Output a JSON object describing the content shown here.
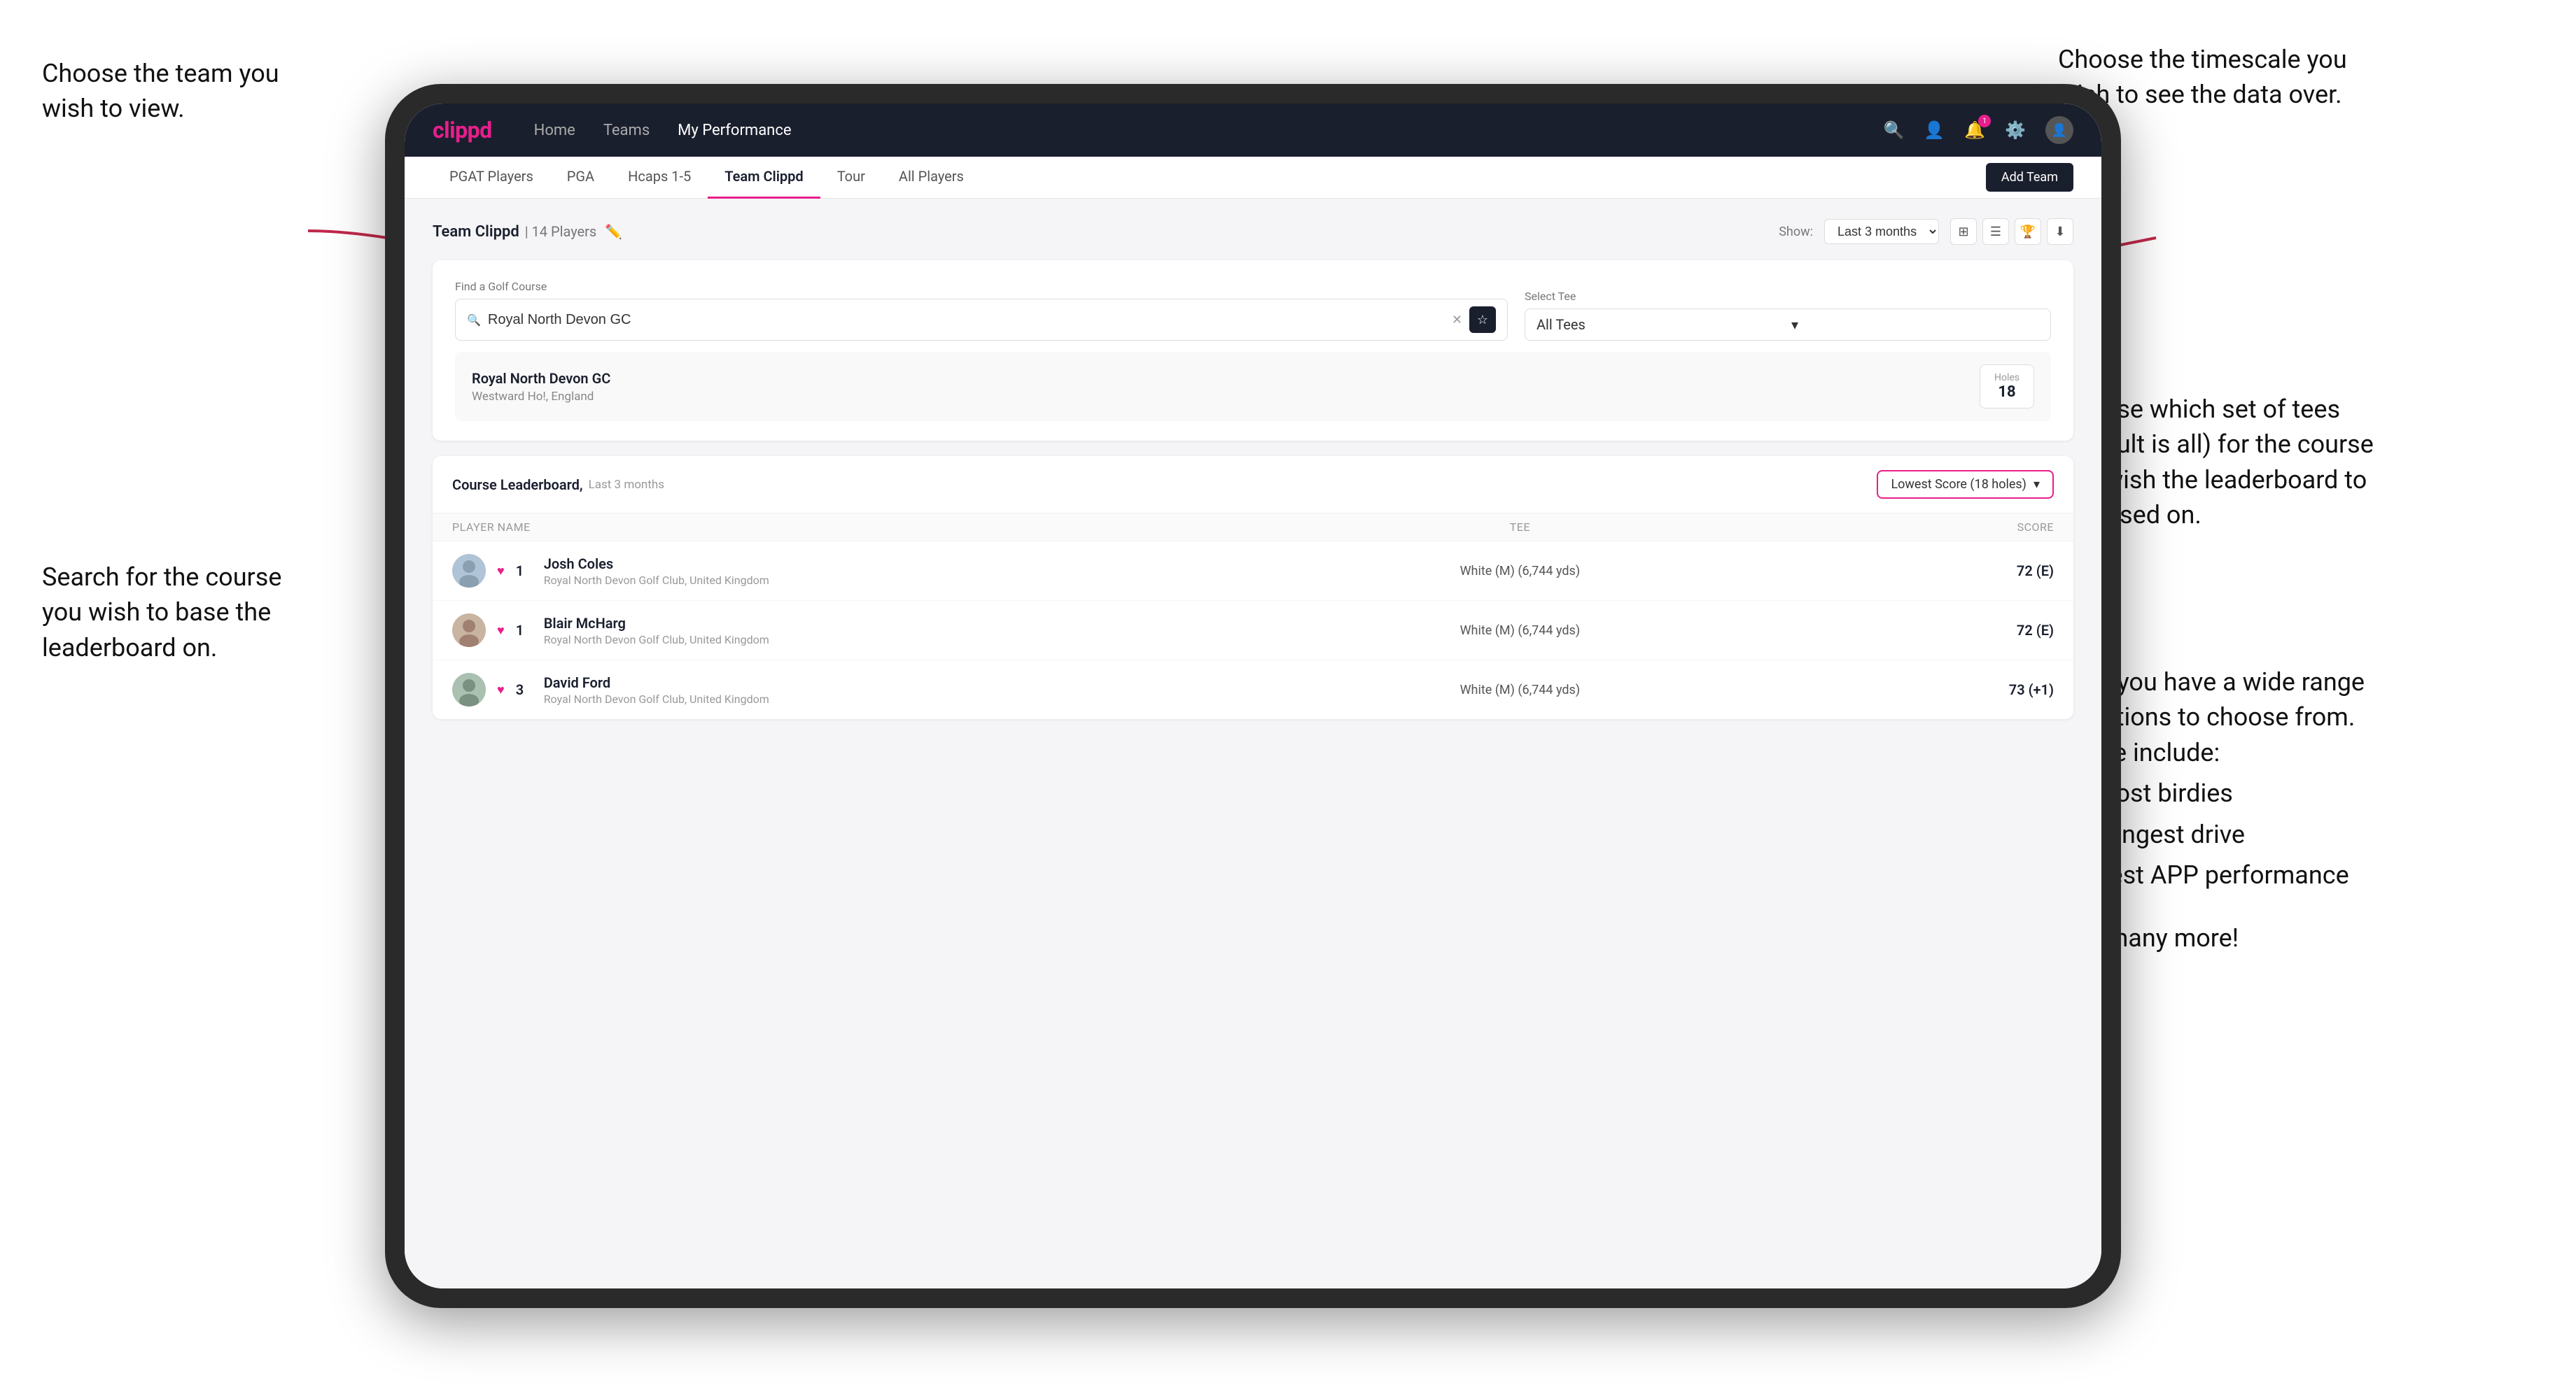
{
  "annotations": {
    "top_left": "Choose the team you\nwish to view.",
    "top_right": "Choose the timescale you\nwish to see the data over.",
    "middle_left": "Search for the course\nyou wish to base the\nleaderboard on.",
    "right_tees": "Choose which set of tees\n(default is all) for the course\nyou wish the leaderboard to\nbe based on.",
    "right_options": "Here you have a wide range\nof options to choose from.\nThese include:",
    "bullet1": "Most birdies",
    "bullet2": "Longest drive",
    "bullet3": "Best APP performance",
    "and_more": "and many more!"
  },
  "nav": {
    "logo": "clippd",
    "links": [
      "Home",
      "Teams",
      "My Performance"
    ],
    "active_link": "My Performance"
  },
  "sub_nav": {
    "tabs": [
      "PGAT Players",
      "PGA",
      "Hcaps 1-5",
      "Team Clippd",
      "Tour",
      "All Players"
    ],
    "active_tab": "Team Clippd",
    "add_team_label": "Add Team"
  },
  "team_section": {
    "title": "Team Clippd",
    "count": "14 Players",
    "show_label": "Show:",
    "show_value": "Last 3 months"
  },
  "search_section": {
    "find_label": "Find a Golf Course",
    "search_value": "Royal North Devon GC",
    "select_tee_label": "Select Tee",
    "tee_value": "All Tees"
  },
  "course_result": {
    "name": "Royal North Devon GC",
    "location": "Westward Ho!, England",
    "holes_label": "Holes",
    "holes_count": "18"
  },
  "leaderboard": {
    "title": "Course Leaderboard,",
    "subtitle": "Last 3 months",
    "score_type": "Lowest Score (18 holes)",
    "columns": {
      "player": "PLAYER NAME",
      "tee": "TEE",
      "score": "SCORE"
    },
    "players": [
      {
        "rank": "1",
        "name": "Josh Coles",
        "club": "Royal North Devon Golf Club, United Kingdom",
        "tee": "White (M) (6,744 yds)",
        "score": "72 (E)"
      },
      {
        "rank": "1",
        "name": "Blair McHarg",
        "club": "Royal North Devon Golf Club, United Kingdom",
        "tee": "White (M) (6,744 yds)",
        "score": "72 (E)"
      },
      {
        "rank": "3",
        "name": "David Ford",
        "club": "Royal North Devon Golf Club, United Kingdom",
        "tee": "White (M) (6,744 yds)",
        "score": "73 (+1)"
      }
    ]
  },
  "colors": {
    "brand_pink": "#e91e8c",
    "nav_dark": "#1a1f2e",
    "text_dark": "#111111"
  }
}
